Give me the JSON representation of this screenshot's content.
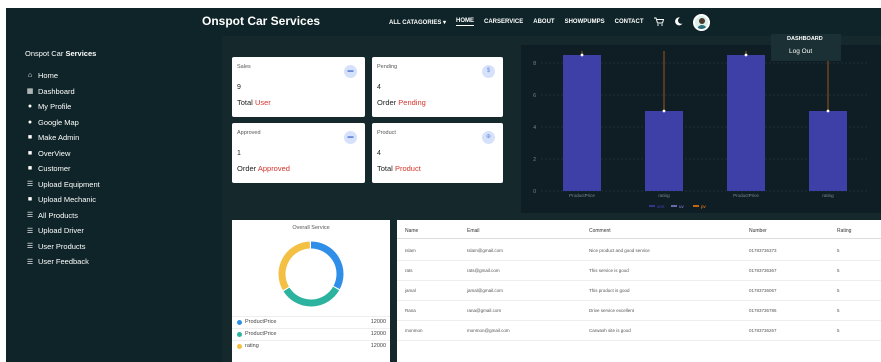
{
  "navbar": {
    "brand": "Onspot Car Services",
    "links": [
      "ALL CATAGORIES ▾",
      "HOME",
      "CARSERVICE",
      "ABOUT",
      "SHOWPUMPS",
      "CONTACT"
    ],
    "active_link": "HOME",
    "icons": [
      "cart-icon",
      "moon-icon"
    ]
  },
  "dropdown": {
    "item1": "DASHBOARD",
    "item2": "Log Out"
  },
  "sidebar": {
    "title_regular": "Onspot Car ",
    "title_bold": "Services",
    "items": [
      {
        "label": "Home",
        "icon": "home-icon"
      },
      {
        "label": "Dashboard",
        "icon": "grid-icon"
      },
      {
        "label": "My Profile",
        "icon": "user-icon"
      },
      {
        "label": "Google Map",
        "icon": "user-icon"
      },
      {
        "label": "Make Admin",
        "icon": "bookmark-icon"
      },
      {
        "label": "OverView",
        "icon": "bookmark-icon"
      },
      {
        "label": "Customer",
        "icon": "bookmark-icon"
      },
      {
        "label": "Upload Equipment",
        "icon": "list-icon"
      },
      {
        "label": "Upload Mechanic",
        "icon": "bookmark-icon"
      },
      {
        "label": "All Products",
        "icon": "list-icon"
      },
      {
        "label": "Upload Driver",
        "icon": "list-icon"
      },
      {
        "label": "User Products",
        "icon": "list-icon"
      },
      {
        "label": "User Feedback",
        "icon": "list-icon"
      }
    ]
  },
  "cards": [
    {
      "label": "Sales",
      "value": "9",
      "sub_prefix": "Total ",
      "sub_highlight": "User",
      "icon": "car-icon"
    },
    {
      "label": "Pending",
      "value": "4",
      "sub_prefix": "Order ",
      "sub_highlight": "Pending",
      "icon": "dollar-icon"
    },
    {
      "label": "Approved",
      "value": "1",
      "sub_prefix": "Order ",
      "sub_highlight": "Approved",
      "icon": "car-icon"
    },
    {
      "label": "Product",
      "value": "4",
      "sub_prefix": "Total ",
      "sub_highlight": "Product",
      "icon": "cart-icon"
    }
  ],
  "chart_data": {
    "type": "bar",
    "categories": [
      "ProductPrice",
      "rating",
      "ProductPrice",
      "rating"
    ],
    "series": [
      {
        "name": "amt",
        "values": [
          8.5,
          5,
          8.5,
          5
        ],
        "color": "#3f3fa8"
      },
      {
        "name": "uv",
        "values": [
          8.5,
          5,
          8.5,
          5
        ],
        "color": "#8884d8"
      },
      {
        "name": "pv",
        "values": [
          8.5,
          5,
          8.5,
          5
        ],
        "color": "#ff7f0e"
      }
    ],
    "yticks": [
      0,
      2,
      4,
      6,
      8
    ],
    "ylim": [
      0,
      8.5
    ],
    "grid": true,
    "legend": "bottom"
  },
  "pie": {
    "title": "Overall Service",
    "segments": [
      {
        "name": "ProductPrice",
        "value": 12000,
        "color": "#2f8fe8"
      },
      {
        "name": "ProductPrice",
        "value": 12000,
        "color": "#2bb39f"
      },
      {
        "name": "rating",
        "value": 12000,
        "color": "#f3c043"
      }
    ],
    "legend": [
      {
        "name": "ProductPrice",
        "value": "12000",
        "color": "#2f8fe8"
      },
      {
        "name": "ProductPrice",
        "value": "12000",
        "color": "#2bb39f"
      },
      {
        "name": "rating",
        "value": "12000",
        "color": "#f3c043"
      }
    ]
  },
  "table": {
    "headers": [
      "Name",
      "Email",
      "Comment",
      "Number",
      "Rating"
    ],
    "rows": [
      [
        "Islam",
        "Islam@gmail.com",
        "Nice product and good service",
        "01783736373",
        "5"
      ],
      [
        "rats",
        "rats@gmail.com",
        "This service is good",
        "01783736367",
        "5"
      ],
      [
        "jamal",
        "jamal@gmail.com",
        "This product is good",
        "01783736067",
        "5"
      ],
      [
        "Rana",
        "rana@gmail.com",
        "Drive service excellent",
        "01783736786",
        "5"
      ],
      [
        "monmon",
        "monmon@gmail.com",
        "Carwash site is good",
        "01783736267",
        "5"
      ]
    ]
  }
}
